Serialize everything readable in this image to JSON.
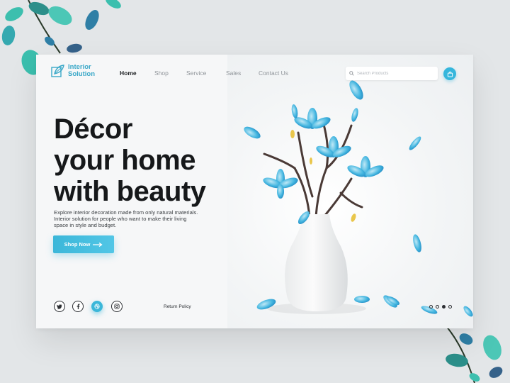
{
  "brand": {
    "line1": "Interior",
    "line2": "Solution"
  },
  "nav": [
    {
      "label": "Home",
      "active": true
    },
    {
      "label": "Shop"
    },
    {
      "label": "Service"
    },
    {
      "label": "Sales"
    },
    {
      "label": "Contact Us"
    }
  ],
  "search": {
    "placeholder": "Search Products"
  },
  "hero": {
    "headline": [
      "Décor",
      "your home",
      "with beauty"
    ],
    "description": [
      "Explore interior decoration made from only natural materials.",
      "Interior solution for people who want to make their living",
      "space in style and budget."
    ],
    "cta_label": "Shop Now"
  },
  "socials": [
    {
      "icon": "twitter-icon"
    },
    {
      "icon": "facebook-icon"
    },
    {
      "icon": "dribbble-icon",
      "active": true
    },
    {
      "icon": "instagram-icon"
    }
  ],
  "footer": {
    "return_policy": "Return Policy"
  },
  "pager": {
    "count": 4,
    "active_index": 2
  },
  "colors": {
    "accent": "#35b6dc",
    "text_dark": "#16181a",
    "petal": "#3fb0dd"
  }
}
